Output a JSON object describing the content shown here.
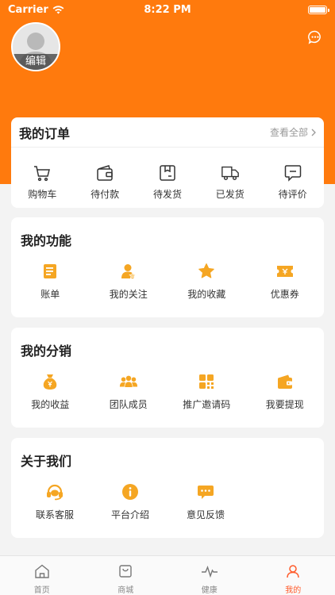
{
  "status_bar": {
    "carrier": "Carrier",
    "time": "8:22 PM"
  },
  "profile": {
    "edit_label": "编辑"
  },
  "orders": {
    "title": "我的订单",
    "view_all": "查看全部",
    "items": [
      {
        "label": "购物车",
        "icon": "cart-icon"
      },
      {
        "label": "待付款",
        "icon": "wallet-icon"
      },
      {
        "label": "待发货",
        "icon": "box-icon"
      },
      {
        "label": "已发货",
        "icon": "truck-icon"
      },
      {
        "label": "待评价",
        "icon": "comment-icon"
      }
    ]
  },
  "functions": {
    "title": "我的功能",
    "items": [
      {
        "label": "账单",
        "icon": "bill-icon"
      },
      {
        "label": "我的关注",
        "icon": "follow-icon"
      },
      {
        "label": "我的收藏",
        "icon": "star-icon"
      },
      {
        "label": "优惠券",
        "icon": "coupon-icon"
      }
    ]
  },
  "distribution": {
    "title": "我的分销",
    "items": [
      {
        "label": "我的收益",
        "icon": "money-bag-icon"
      },
      {
        "label": "团队成员",
        "icon": "team-icon"
      },
      {
        "label": "推广邀请码",
        "icon": "qrcode-icon"
      },
      {
        "label": "我要提现",
        "icon": "withdraw-wallet-icon"
      }
    ]
  },
  "about": {
    "title": "关于我们",
    "items": [
      {
        "label": "联系客服",
        "icon": "headset-icon"
      },
      {
        "label": "平台介绍",
        "icon": "info-icon"
      },
      {
        "label": "意见反馈",
        "icon": "feedback-icon"
      }
    ]
  },
  "tabbar": {
    "items": [
      {
        "label": "首页",
        "icon": "home-icon"
      },
      {
        "label": "商城",
        "icon": "shop-bag-icon"
      },
      {
        "label": "健康",
        "icon": "pulse-icon"
      },
      {
        "label": "我的",
        "icon": "user-icon"
      }
    ],
    "active_index": 3
  },
  "colors": {
    "brand": "#ff7a0d",
    "icon_orange": "#f5a623",
    "tab_active": "#ff5a2a"
  }
}
